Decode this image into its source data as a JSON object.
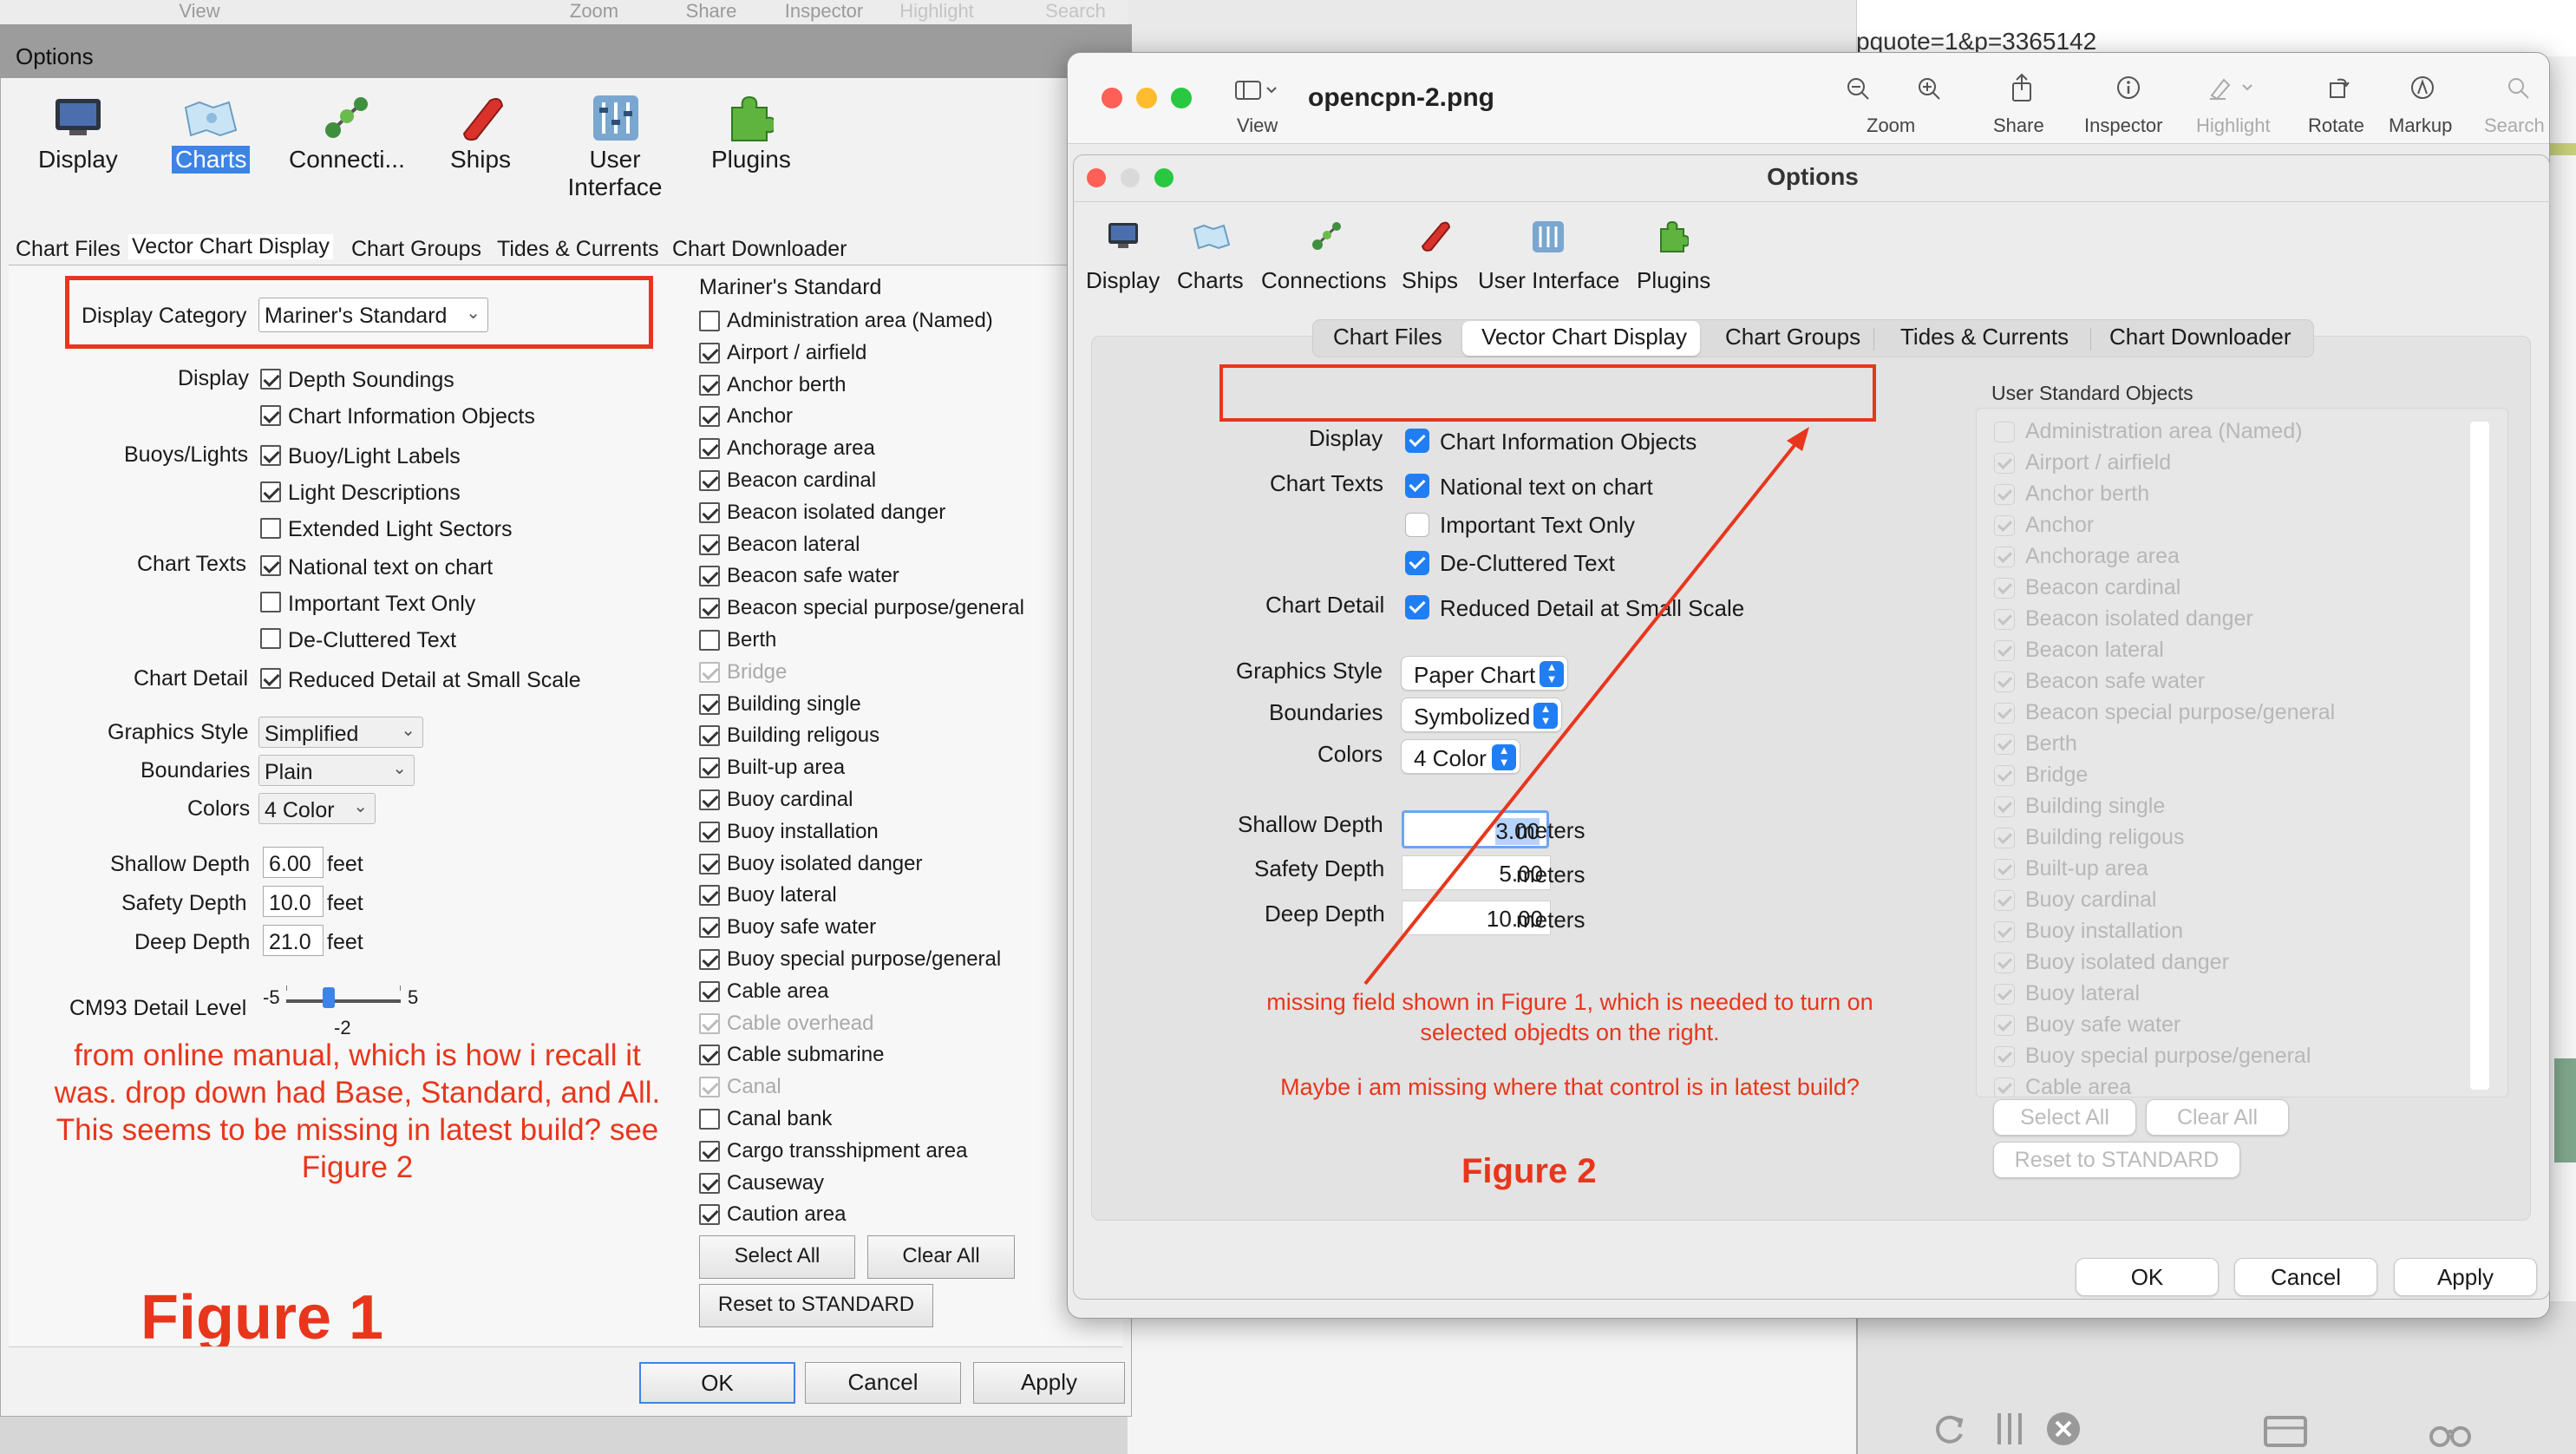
{
  "bg_toolbar": {
    "view": "View",
    "zoom": "Zoom",
    "share": "Share",
    "inspector": "Inspector",
    "highlight": "Highlight",
    "search": "Search",
    "url": "pquote=1&p=3365142"
  },
  "fig1": {
    "title": "Options",
    "toolbar": [
      {
        "label": "Display",
        "icon": "display-icon"
      },
      {
        "label": "Charts",
        "icon": "charts-icon"
      },
      {
        "label": "Connecti...",
        "icon": "connections-icon"
      },
      {
        "label": "Ships",
        "icon": "ships-icon"
      },
      {
        "label": "User Interface",
        "icon": "user-interface-icon"
      },
      {
        "label": "Plugins",
        "icon": "plugins-icon"
      }
    ],
    "tabs": [
      "Chart Files",
      "Vector Chart Display",
      "Chart Groups",
      "Tides & Currents",
      "Chart Downloader"
    ],
    "display_category_label": "Display Category",
    "display_category_value": "Mariner's Standard",
    "display_label": "Display",
    "depth_soundings": "Depth Soundings",
    "chart_info_objects": "Chart Information Objects",
    "buoys_label": "Buoys/Lights",
    "buoy_light_labels": "Buoy/Light Labels",
    "light_descriptions": "Light Descriptions",
    "extended_light_sectors": "Extended Light Sectors",
    "chart_texts_label": "Chart Texts",
    "national_text": "National text on chart",
    "important_text": "Important Text Only",
    "decluttered_text": "De-Cluttered Text",
    "chart_detail_label": "Chart Detail",
    "reduced_detail": "Reduced Detail at Small Scale",
    "graphics_style_label": "Graphics Style",
    "graphics_style_value": "Simplified",
    "boundaries_label": "Boundaries",
    "boundaries_value": "Plain",
    "colors_label": "Colors",
    "colors_value": "4 Color",
    "shallow_label": "Shallow Depth",
    "shallow_value": "6.00",
    "safety_label": "Safety Depth",
    "safety_value": "10.0",
    "deep_label": "Deep Depth",
    "deep_value": "21.0",
    "unit": "feet",
    "cm93_label": "CM93 Detail Level",
    "cm93_min": "-5",
    "cm93_max": "5",
    "cm93_value": "-2",
    "annotation": "from online manual, which is how i recall it was. drop down had Base, Standard, and All. This seems to be missing in latest build?  see Figure 2",
    "figure_label": "Figure 1",
    "list_header": "Mariner's Standard",
    "objects": [
      {
        "name": "Administration area (Named)",
        "checked": false,
        "disabled": false
      },
      {
        "name": "Airport / airfield",
        "checked": true,
        "disabled": false
      },
      {
        "name": "Anchor berth",
        "checked": true,
        "disabled": false
      },
      {
        "name": "Anchor",
        "checked": true,
        "disabled": false
      },
      {
        "name": "Anchorage area",
        "checked": true,
        "disabled": false
      },
      {
        "name": "Beacon cardinal",
        "checked": true,
        "disabled": false
      },
      {
        "name": "Beacon isolated danger",
        "checked": true,
        "disabled": false
      },
      {
        "name": "Beacon lateral",
        "checked": true,
        "disabled": false
      },
      {
        "name": "Beacon safe water",
        "checked": true,
        "disabled": false
      },
      {
        "name": "Beacon special purpose/general",
        "checked": true,
        "disabled": false
      },
      {
        "name": "Berth",
        "checked": false,
        "disabled": false
      },
      {
        "name": "Bridge",
        "checked": true,
        "disabled": true
      },
      {
        "name": "Building single",
        "checked": true,
        "disabled": false
      },
      {
        "name": "Building religous",
        "checked": true,
        "disabled": false
      },
      {
        "name": "Built-up area",
        "checked": true,
        "disabled": false
      },
      {
        "name": "Buoy cardinal",
        "checked": true,
        "disabled": false
      },
      {
        "name": "Buoy installation",
        "checked": true,
        "disabled": false
      },
      {
        "name": "Buoy isolated danger",
        "checked": true,
        "disabled": false
      },
      {
        "name": "Buoy lateral",
        "checked": true,
        "disabled": false
      },
      {
        "name": "Buoy safe water",
        "checked": true,
        "disabled": false
      },
      {
        "name": "Buoy special purpose/general",
        "checked": true,
        "disabled": false
      },
      {
        "name": "Cable area",
        "checked": true,
        "disabled": false
      },
      {
        "name": "Cable overhead",
        "checked": true,
        "disabled": true
      },
      {
        "name": "Cable submarine",
        "checked": true,
        "disabled": false
      },
      {
        "name": "Canal",
        "checked": true,
        "disabled": true
      },
      {
        "name": "Canal bank",
        "checked": false,
        "disabled": false
      },
      {
        "name": "Cargo transshipment area",
        "checked": true,
        "disabled": false
      },
      {
        "name": "Causeway",
        "checked": true,
        "disabled": false
      },
      {
        "name": "Caution area",
        "checked": true,
        "disabled": false
      }
    ],
    "select_all": "Select All",
    "clear_all": "Clear All",
    "reset": "Reset to STANDARD",
    "ok": "OK",
    "cancel": "Cancel",
    "apply": "Apply"
  },
  "fig2": {
    "window_title": "opencpn-2.png",
    "tb_view": "View",
    "tb_zoom": "Zoom",
    "tb_share": "Share",
    "tb_inspector": "Inspector",
    "tb_highlight": "Highlight",
    "tb_rotate": "Rotate",
    "tb_markup": "Markup",
    "tb_search": "Search",
    "dialog_title": "Options",
    "toolbar": [
      {
        "label": "Display",
        "icon": "display-icon"
      },
      {
        "label": "Charts",
        "icon": "charts-icon"
      },
      {
        "label": "Connections",
        "icon": "connections-icon"
      },
      {
        "label": "Ships",
        "icon": "ships-icon"
      },
      {
        "label": "User Interface",
        "icon": "user-interface-icon"
      },
      {
        "label": "Plugins",
        "icon": "plugins-icon"
      }
    ],
    "tabs": [
      "Chart Files",
      "Vector Chart Display",
      "Chart Groups",
      "Tides & Currents",
      "Chart Downloader"
    ],
    "display_label": "Display",
    "chart_info_objects": "Chart Information Objects",
    "chart_texts_label": "Chart Texts",
    "national_text": "National text on chart",
    "important_text": "Important Text Only",
    "decluttered_text": "De-Cluttered Text",
    "chart_detail_label": "Chart Detail",
    "reduced_detail": "Reduced Detail at Small Scale",
    "graphics_style_label": "Graphics Style",
    "graphics_style_value": "Paper Chart",
    "boundaries_label": "Boundaries",
    "boundaries_value": "Symbolized",
    "colors_label": "Colors",
    "colors_value": "4 Color",
    "shallow_label": "Shallow Depth",
    "shallow_value": "3.00",
    "safety_label": "Safety Depth",
    "safety_value": "5.00",
    "deep_label": "Deep Depth",
    "deep_value": "10.00",
    "unit": "meters",
    "annotation1": "missing field shown in Figure 1, which is needed to turn on selected objedts on the right.",
    "annotation2": "Maybe i am missing where that control is in latest build?",
    "figure_label": "Figure 2",
    "list_header": "User Standard Objects",
    "objects": [
      {
        "name": "Administration area (Named)",
        "checked": false
      },
      {
        "name": "Airport / airfield",
        "checked": true
      },
      {
        "name": "Anchor berth",
        "checked": true
      },
      {
        "name": "Anchor",
        "checked": true
      },
      {
        "name": "Anchorage area",
        "checked": true
      },
      {
        "name": "Beacon cardinal",
        "checked": true
      },
      {
        "name": "Beacon isolated danger",
        "checked": true
      },
      {
        "name": "Beacon lateral",
        "checked": true
      },
      {
        "name": "Beacon safe water",
        "checked": true
      },
      {
        "name": "Beacon special purpose/general",
        "checked": true
      },
      {
        "name": "Berth",
        "checked": true
      },
      {
        "name": "Bridge",
        "checked": true
      },
      {
        "name": "Building single",
        "checked": true
      },
      {
        "name": "Building religous",
        "checked": true
      },
      {
        "name": "Built-up area",
        "checked": true
      },
      {
        "name": "Buoy cardinal",
        "checked": true
      },
      {
        "name": "Buoy installation",
        "checked": true
      },
      {
        "name": "Buoy isolated danger",
        "checked": true
      },
      {
        "name": "Buoy lateral",
        "checked": true
      },
      {
        "name": "Buoy safe water",
        "checked": true
      },
      {
        "name": "Buoy special purpose/general",
        "checked": true
      },
      {
        "name": "Cable area",
        "checked": true
      }
    ],
    "select_all": "Select All",
    "clear_all": "Clear All",
    "reset": "Reset to STANDARD",
    "ok": "OK",
    "cancel": "Cancel",
    "apply": "Apply"
  },
  "colors": {
    "annotation_red": "#e8361c",
    "accent_blue": "#1f7ef4",
    "charts_highlight": "#3c84e6"
  }
}
